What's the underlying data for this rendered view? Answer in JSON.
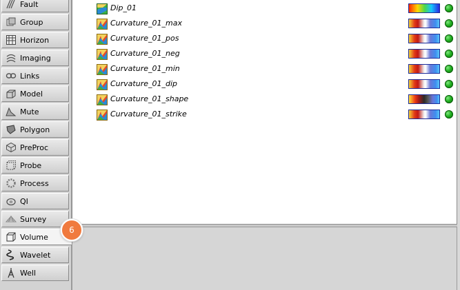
{
  "sidebar": {
    "items": [
      {
        "label": "Fault",
        "icon": "fault-icon"
      },
      {
        "label": "Group",
        "icon": "group-icon"
      },
      {
        "label": "Horizon",
        "icon": "horizon-icon"
      },
      {
        "label": "Imaging",
        "icon": "imaging-icon"
      },
      {
        "label": "Links",
        "icon": "links-icon"
      },
      {
        "label": "Model",
        "icon": "model-icon"
      },
      {
        "label": "Mute",
        "icon": "mute-icon"
      },
      {
        "label": "Polygon",
        "icon": "polygon-icon"
      },
      {
        "label": "PreProc",
        "icon": "preproc-icon"
      },
      {
        "label": "Probe",
        "icon": "probe-icon"
      },
      {
        "label": "Process",
        "icon": "process-icon"
      },
      {
        "label": "QI",
        "icon": "qi-icon"
      },
      {
        "label": "Survey",
        "icon": "survey-icon"
      },
      {
        "label": "Volume",
        "icon": "volume-icon",
        "selected": true
      },
      {
        "label": "Wavelet",
        "icon": "wavelet-icon"
      },
      {
        "label": "Well",
        "icon": "well-icon"
      }
    ]
  },
  "volumes": [
    {
      "name": "Dip_01",
      "colorbar": "rainbow",
      "status": "ok",
      "status_color": "#1fae1f"
    },
    {
      "name": "Curvature_01_max",
      "colorbar": "red-white-blue",
      "status": "ok",
      "status_color": "#1fae1f"
    },
    {
      "name": "Curvature_01_pos",
      "colorbar": "red-white-blue",
      "status": "ok",
      "status_color": "#1fae1f"
    },
    {
      "name": "Curvature_01_neg",
      "colorbar": "red-white-blue",
      "status": "ok",
      "status_color": "#1fae1f"
    },
    {
      "name": "Curvature_01_min",
      "colorbar": "red-white-blue",
      "status": "ok",
      "status_color": "#1fae1f"
    },
    {
      "name": "Curvature_01_dip",
      "colorbar": "red-white-blue",
      "status": "ok",
      "status_color": "#1fae1f"
    },
    {
      "name": "Curvature_01_shape",
      "colorbar": "shape",
      "status": "ok",
      "status_color": "#1fae1f"
    },
    {
      "name": "Curvature_01_strike",
      "colorbar": "red-white-blue",
      "status": "ok",
      "status_color": "#1fae1f"
    }
  ],
  "step_badge": "6",
  "colors": {
    "badge": "#f07a3e",
    "status_ok": "#1fae1f",
    "colorbar_border": "#1d2c9a"
  }
}
